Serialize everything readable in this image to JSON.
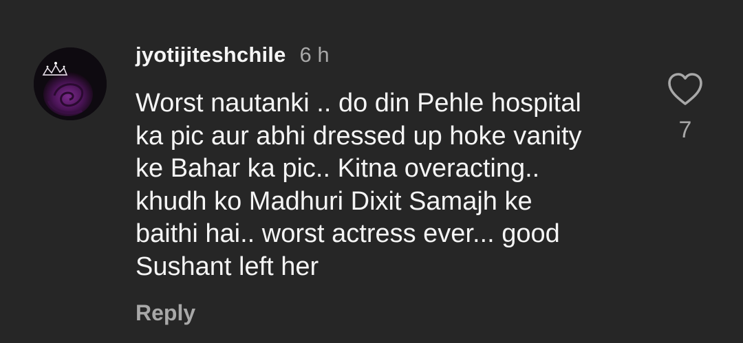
{
  "comment": {
    "username": "jyotijiteshchile",
    "time": "6 h",
    "text": "Worst nautanki .. do din Pehle hospital\nka pic aur abhi dressed up hoke vanity\nke Bahar ka pic.. Kitna  overacting..\nkhudh ko Madhuri Dixit Samajh ke\nbaithi hai.. worst actress ever... good\nSushant left her",
    "reply_label": "Reply",
    "like_count": "7",
    "like_icon": "heart-outline-icon",
    "avatar_image": "purple-rose-with-tiara"
  },
  "colors": {
    "background": "#262626",
    "primary_text": "#f5f5f5",
    "secondary_text": "#a8a8a8"
  }
}
